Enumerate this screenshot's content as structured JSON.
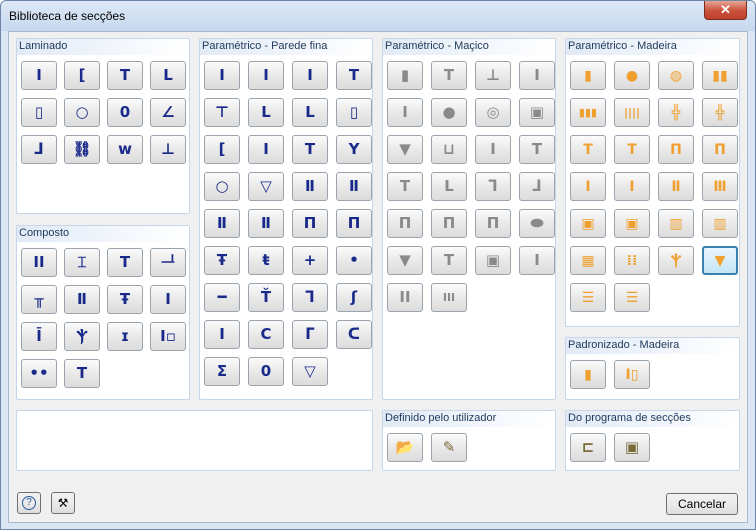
{
  "window": {
    "title": "Biblioteca de secções",
    "close_glyph": "✕"
  },
  "groups": [
    {
      "id": "laminado",
      "title": "Laminado",
      "buttons": [
        {
          "n": "i-section",
          "g": "I"
        },
        {
          "n": "channel-section",
          "g": "["
        },
        {
          "n": "tee-section",
          "g": "T"
        },
        {
          "n": "angle-section",
          "g": "L"
        },
        {
          "n": "rect-hollow",
          "g": "▯"
        },
        {
          "n": "circ-hollow",
          "g": "○"
        },
        {
          "n": "ellipse-hollow",
          "g": "0"
        },
        {
          "n": "unequal-angle",
          "g": "∠"
        },
        {
          "n": "z-section",
          "g": "ᒧ"
        },
        {
          "n": "rail-section",
          "g": "⛓"
        },
        {
          "n": "sheet-pile",
          "g": "w"
        },
        {
          "n": "bulb-flat",
          "g": "⊥"
        }
      ]
    },
    {
      "id": "composto",
      "title": "Composto",
      "buttons": [
        {
          "n": "double-i",
          "g": "II"
        },
        {
          "n": "i-channel",
          "g": "⌶"
        },
        {
          "n": "tee-channel",
          "g": "T"
        },
        {
          "n": "double-tee",
          "g": "ᆜ"
        },
        {
          "n": "double-angle-tee",
          "g": "╥"
        },
        {
          "n": "i-plate",
          "g": "Ⅱ"
        },
        {
          "n": "i-cover",
          "g": "Ŧ"
        },
        {
          "n": "i-flange",
          "g": "I"
        },
        {
          "n": "i-web",
          "g": "Ī"
        },
        {
          "n": "i-stiff",
          "g": "Ⲯ"
        },
        {
          "n": "i-slim",
          "g": "ɪ"
        },
        {
          "n": "i-box",
          "g": "I▫"
        },
        {
          "n": "two-bars",
          "g": "••"
        },
        {
          "n": "t-plate",
          "g": "T"
        }
      ]
    },
    {
      "id": "param-fina",
      "title": "Paramétrico - Parede fina",
      "buttons": [
        {
          "n": "pf-i",
          "g": "I"
        },
        {
          "n": "pf-i2",
          "g": "I"
        },
        {
          "n": "pf-i3",
          "g": "I"
        },
        {
          "n": "pf-t",
          "g": "T"
        },
        {
          "n": "pf-t2",
          "g": "⊤"
        },
        {
          "n": "pf-l",
          "g": "L"
        },
        {
          "n": "pf-l2",
          "g": "L"
        },
        {
          "n": "pf-rect",
          "g": "▯"
        },
        {
          "n": "pf-c",
          "g": "["
        },
        {
          "n": "pf-i4",
          "g": "I"
        },
        {
          "n": "pf-t3",
          "g": "T"
        },
        {
          "n": "pf-y",
          "g": "Y"
        },
        {
          "n": "pf-circ",
          "g": "○"
        },
        {
          "n": "pf-tri",
          "g": "▽"
        },
        {
          "n": "pf-box2",
          "g": "Ⅱ"
        },
        {
          "n": "pf-box3",
          "g": "Ⅱ"
        },
        {
          "n": "pf-box4",
          "g": "Ⅱ"
        },
        {
          "n": "pf-box5",
          "g": "Ⅱ"
        },
        {
          "n": "pf-pi",
          "g": "Π"
        },
        {
          "n": "pf-pi2",
          "g": "Π"
        },
        {
          "n": "pf-cross",
          "g": "Ŧ"
        },
        {
          "n": "pf-cross2",
          "g": "ŧ"
        },
        {
          "n": "pf-plus",
          "g": "+"
        },
        {
          "n": "pf-dot",
          "g": "•"
        },
        {
          "n": "pf-flat",
          "g": "━"
        },
        {
          "n": "pf-t4",
          "g": "Ť"
        },
        {
          "n": "pf-z",
          "g": "ᒣ"
        },
        {
          "n": "pf-s",
          "g": "ʃ"
        },
        {
          "n": "pf-i5",
          "g": "I"
        },
        {
          "n": "pf-c2",
          "g": "C"
        },
        {
          "n": "pf-z2",
          "g": "ᒥ"
        },
        {
          "n": "pf-c3",
          "g": "ᑕ"
        },
        {
          "n": "pf-sigma",
          "g": "Σ"
        },
        {
          "n": "pf-ellipse",
          "g": "0"
        },
        {
          "n": "pf-trap",
          "g": "▽"
        }
      ]
    },
    {
      "id": "param-macico",
      "title": "Paramétrico - Maçico",
      "buttons": [
        {
          "n": "pm-rect",
          "g": "▮"
        },
        {
          "n": "pm-t",
          "g": "T"
        },
        {
          "n": "pm-inv-t",
          "g": "⊥"
        },
        {
          "n": "pm-i",
          "g": "I"
        },
        {
          "n": "pm-i2",
          "g": "I"
        },
        {
          "n": "pm-circle",
          "g": "●"
        },
        {
          "n": "pm-ring",
          "g": "◎"
        },
        {
          "n": "pm-hollow-rect",
          "g": "▣"
        },
        {
          "n": "pm-trap",
          "g": "▼"
        },
        {
          "n": "pm-u",
          "g": "⊔"
        },
        {
          "n": "pm-i3",
          "g": "I"
        },
        {
          "n": "pm-t2",
          "g": "T"
        },
        {
          "n": "pm-t3",
          "g": "T"
        },
        {
          "n": "pm-l",
          "g": "L"
        },
        {
          "n": "pm-z",
          "g": "ᒣ"
        },
        {
          "n": "pm-z2",
          "g": "ᒧ"
        },
        {
          "n": "pm-pi",
          "g": "Π"
        },
        {
          "n": "pm-pi2",
          "g": "Π"
        },
        {
          "n": "pm-pi3",
          "g": "Π"
        },
        {
          "n": "pm-oval",
          "g": "⬬"
        },
        {
          "n": "pm-tri",
          "g": "▼"
        },
        {
          "n": "pm-t4",
          "g": "T"
        },
        {
          "n": "pm-box",
          "g": "▣"
        },
        {
          "n": "pm-i4",
          "g": "I"
        },
        {
          "n": "pm-ii",
          "g": "II"
        },
        {
          "n": "pm-iii",
          "g": "III"
        }
      ]
    },
    {
      "id": "param-madeira",
      "title": "Paramétrico - Madeira",
      "buttons": [
        {
          "n": "wd-rect",
          "g": "▮"
        },
        {
          "n": "wd-circle",
          "g": "●"
        },
        {
          "n": "wd-circle-split",
          "g": "◍"
        },
        {
          "n": "wd-two",
          "g": "▮▮"
        },
        {
          "n": "wd-three",
          "g": "▮▮▮"
        },
        {
          "n": "wd-four",
          "g": "||||"
        },
        {
          "n": "wd-cross",
          "g": "╬"
        },
        {
          "n": "wd-cross2",
          "g": "╬"
        },
        {
          "n": "wd-t",
          "g": "T"
        },
        {
          "n": "wd-t2",
          "g": "T"
        },
        {
          "n": "wd-pi",
          "g": "Π"
        },
        {
          "n": "wd-pi2",
          "g": "Π"
        },
        {
          "n": "wd-i",
          "g": "I"
        },
        {
          "n": "wd-i2",
          "g": "I"
        },
        {
          "n": "wd-i3",
          "g": "Ⅱ"
        },
        {
          "n": "wd-i4",
          "g": "Ⅲ"
        },
        {
          "n": "wd-box",
          "g": "▣"
        },
        {
          "n": "wd-box2",
          "g": "▣"
        },
        {
          "n": "wd-box3",
          "g": "▥"
        },
        {
          "n": "wd-box4",
          "g": "▥"
        },
        {
          "n": "wd-grid",
          "g": "▦"
        },
        {
          "n": "wd-grid2",
          "g": "⁞⁞"
        },
        {
          "n": "wd-i5",
          "g": "Ⲯ"
        },
        {
          "n": "wd-trap",
          "g": "▼",
          "sel": true
        },
        {
          "n": "wd-lam",
          "g": "☰"
        },
        {
          "n": "wd-lam2",
          "g": "☰"
        }
      ]
    },
    {
      "id": "padronizado",
      "title": "Padronizado - Madeira",
      "buttons": [
        {
          "n": "std-rect",
          "g": "▮"
        },
        {
          "n": "std-double",
          "g": "I▯"
        }
      ]
    },
    {
      "id": "definido",
      "title": "Definido pelo utilizador",
      "buttons": [
        {
          "n": "open-folder",
          "g": "📂"
        },
        {
          "n": "edit-section",
          "g": "✎"
        }
      ]
    },
    {
      "id": "programa",
      "title": "Do programa de secções",
      "buttons": [
        {
          "n": "shape-thin",
          "g": "⊏"
        },
        {
          "n": "shape-massive",
          "g": "▣"
        }
      ]
    }
  ],
  "footer": {
    "help_glyph": "?",
    "units_glyph": "⚒",
    "cancel_label": "Cancelar"
  },
  "colors": {
    "accent": "#1a2a8a",
    "wood": "#f0a030",
    "selection": "#3c7fb1"
  }
}
